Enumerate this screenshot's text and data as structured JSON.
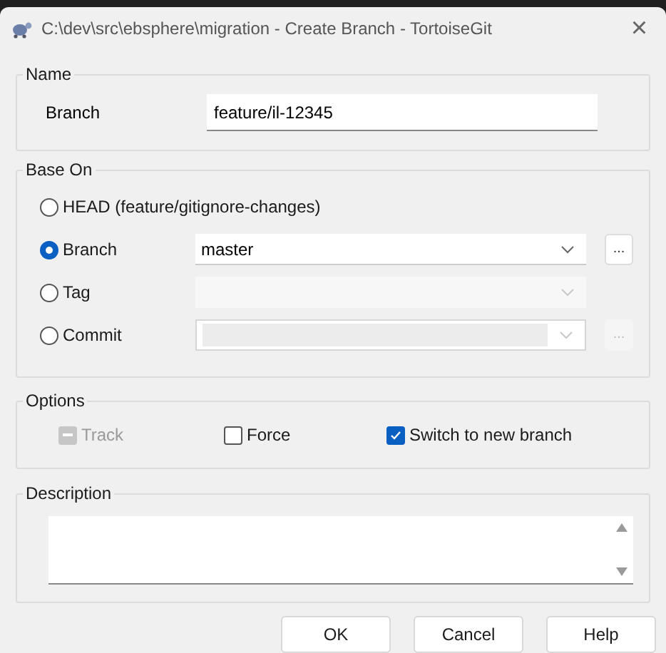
{
  "window": {
    "title": "C:\\dev\\src\\ebsphere\\migration - Create Branch - TortoiseGit",
    "close": "×"
  },
  "name_group": {
    "title": "Name",
    "label": "Branch",
    "value": "feature/il-12345"
  },
  "base_on": {
    "title": "Base On",
    "options": [
      {
        "kind": "plain",
        "label": "HEAD (feature/gitignore-changes)",
        "selected": false
      },
      {
        "kind": "combo",
        "label": "Branch",
        "selected": true,
        "value": "master",
        "disabled": false,
        "browse": {
          "label": "...",
          "disabled": false
        }
      },
      {
        "kind": "combo",
        "label": "Tag",
        "selected": false,
        "disabled": true
      },
      {
        "kind": "editcombo",
        "label": "Commit",
        "selected": false,
        "disabled": true,
        "browse": {
          "label": "...",
          "disabled": true
        }
      }
    ]
  },
  "options": {
    "title": "Options",
    "checkboxes": [
      {
        "label": "Track",
        "checked": false,
        "indeterminate": true,
        "disabled": true
      },
      {
        "label": "Force",
        "checked": false,
        "indeterminate": false,
        "disabled": false
      },
      {
        "label": "Switch to new branch",
        "checked": true,
        "indeterminate": false,
        "disabled": false
      }
    ]
  },
  "description": {
    "title": "Description"
  },
  "buttons": [
    "OK",
    "Cancel",
    "Help"
  ]
}
